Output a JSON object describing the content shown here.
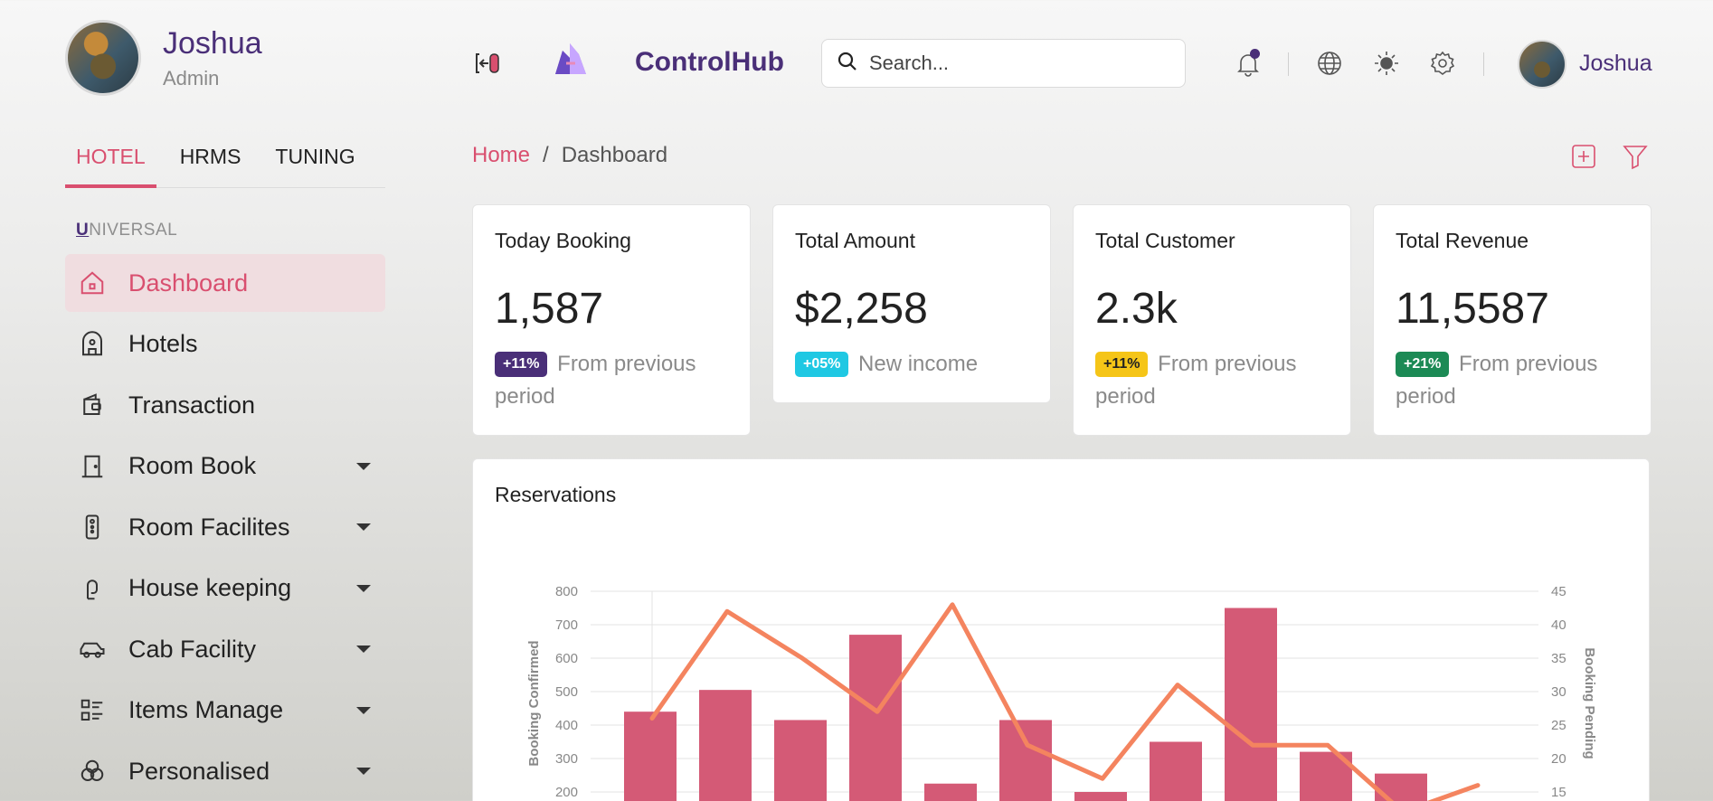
{
  "profile": {
    "name": "Joshua",
    "role": "Admin"
  },
  "tabs": [
    {
      "label": "HOTEL",
      "active": true
    },
    {
      "label": "HRMS",
      "active": false
    },
    {
      "label": "TUNING",
      "active": false
    }
  ],
  "section": {
    "first_letter": "U",
    "rest": "NIVERSAL"
  },
  "menu": [
    {
      "label": "Dashboard",
      "icon": "home-icon",
      "active": true,
      "has_caret": false
    },
    {
      "label": "Hotels",
      "icon": "building-icon",
      "active": false,
      "has_caret": false
    },
    {
      "label": "Transaction",
      "icon": "wallet-icon",
      "active": false,
      "has_caret": false
    },
    {
      "label": "Room Book",
      "icon": "door-icon",
      "active": false,
      "has_caret": true
    },
    {
      "label": "Room Facilites",
      "icon": "remote-icon",
      "active": false,
      "has_caret": true
    },
    {
      "label": "House keeping",
      "icon": "hand-icon",
      "active": false,
      "has_caret": true
    },
    {
      "label": "Cab Facility",
      "icon": "car-icon",
      "active": false,
      "has_caret": true
    },
    {
      "label": "Items Manage",
      "icon": "list-icon",
      "active": false,
      "has_caret": true
    },
    {
      "label": "Personalised",
      "icon": "circles-icon",
      "active": false,
      "has_caret": true
    }
  ],
  "header": {
    "brand": "ControlHub",
    "search_placeholder": "Search...",
    "user_name": "Joshua",
    "icons": [
      "collapse-sidebar-icon",
      "logo-icon",
      "bell-icon",
      "globe-icon",
      "sun-icon",
      "gear-icon"
    ]
  },
  "breadcrumb": {
    "home": "Home",
    "separator": "/",
    "current": "Dashboard"
  },
  "cards": [
    {
      "title": "Today Booking",
      "value": "1,587",
      "badge": "+11%",
      "badge_color": "#4a2f78",
      "note": "From previous period"
    },
    {
      "title": "Total Amount",
      "value": "$2,258",
      "badge": "+05%",
      "badge_color": "#1fc8e3",
      "note": "New income"
    },
    {
      "title": "Total Customer",
      "value": "2.3k",
      "badge": "+11%",
      "badge_color": "#f5c518",
      "note": "From previous period"
    },
    {
      "title": "Total Revenue",
      "value": "11,5587",
      "badge": "+21%",
      "badge_color": "#1c8a55",
      "note": "From previous period"
    }
  ],
  "colors": {
    "accent": "#d94f6f",
    "brand": "#4a2f78",
    "line": "#f4845f",
    "bar": "#d45a76"
  },
  "chart_title": "Reservations",
  "chart_data": {
    "type": "bar",
    "ylabel": "Booking Confirmed",
    "y2label": "Booking Pending",
    "yticks": [
      200,
      300,
      400,
      500,
      600,
      700,
      800
    ],
    "y2ticks": [
      15,
      20,
      25,
      30,
      35,
      40,
      45
    ],
    "series": [
      {
        "values": [
          440,
          505,
          415,
          670,
          225,
          415,
          200,
          350,
          750,
          320,
          255
        ]
      },
      {
        "values": [
          26,
          42,
          35,
          27,
          43,
          22,
          17,
          31,
          22,
          22,
          12,
          16
        ]
      }
    ]
  }
}
